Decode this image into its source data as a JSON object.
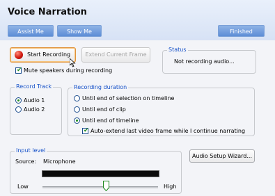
{
  "header": {
    "title": "Voice Narration",
    "assist_label": "Assist Me",
    "show_label": "Show Me",
    "finished_label": "Finished"
  },
  "controls": {
    "start_recording_label": "Start Recording",
    "extend_frame_label": "Extend Current Frame",
    "mute_label": "Mute speakers during recording",
    "mute_checked": true
  },
  "status": {
    "legend": "Status",
    "text": "Not recording audio..."
  },
  "record_track": {
    "legend": "Record Track",
    "options": [
      "Audio 1",
      "Audio 2"
    ],
    "selected": "Audio 1"
  },
  "recording_duration": {
    "legend": "Recording duration",
    "options": [
      "Until end of selection on timeline",
      "Until end of clip",
      "Until end of timeline"
    ],
    "selected": "Until end of timeline",
    "auto_extend_label": "Auto-extend last video frame while I continue narrating",
    "auto_extend_checked": true
  },
  "input_level": {
    "legend": "Input level",
    "source_label": "Source:",
    "source_value": "Microphone",
    "level_fraction": 0.0,
    "low_label": "Low",
    "high_label": "High",
    "slider_fraction": 0.55
  },
  "audio_setup_label": "Audio Setup Wizard...",
  "colors": {
    "accent_blue": "#1450c8",
    "header_button": "#6a97da",
    "level_meter_bg": "#0b0b0b",
    "record_red": "#d41a10"
  }
}
